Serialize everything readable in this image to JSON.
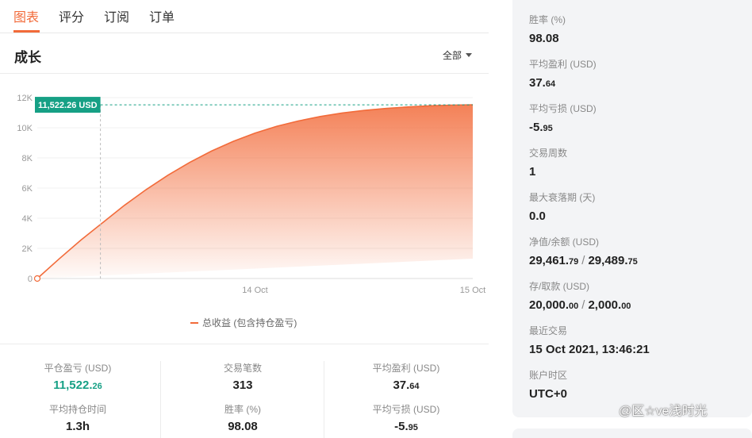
{
  "tabs": [
    {
      "label": "图表",
      "active": true
    },
    {
      "label": "评分",
      "active": false
    },
    {
      "label": "订阅",
      "active": false
    },
    {
      "label": "订单",
      "active": false
    }
  ],
  "growth": {
    "title": "成长",
    "filter_label": "全部"
  },
  "chart_data": {
    "type": "area",
    "series": [
      {
        "name": "总收益 (包含持仓盈亏)",
        "color": "#f26b3a",
        "points": [
          [
            0,
            0
          ],
          [
            0.05,
            1300
          ],
          [
            0.1,
            2550
          ],
          [
            0.15,
            3700
          ],
          [
            0.2,
            4850
          ],
          [
            0.25,
            5900
          ],
          [
            0.3,
            6850
          ],
          [
            0.35,
            7700
          ],
          [
            0.4,
            8450
          ],
          [
            0.45,
            9100
          ],
          [
            0.5,
            9650
          ],
          [
            0.55,
            10100
          ],
          [
            0.6,
            10450
          ],
          [
            0.65,
            10750
          ],
          [
            0.7,
            10980
          ],
          [
            0.75,
            11150
          ],
          [
            0.8,
            11280
          ],
          [
            0.85,
            11380
          ],
          [
            0.9,
            11450
          ],
          [
            0.95,
            11500
          ],
          [
            1.0,
            11522.26
          ]
        ]
      }
    ],
    "y_ticks": [
      "0",
      "2K",
      "4K",
      "6K",
      "8K",
      "10K",
      "12K"
    ],
    "y_tick_values": [
      0,
      2000,
      4000,
      6000,
      8000,
      10000,
      12000
    ],
    "x_ticks": [
      {
        "label": "14 Oct",
        "value": 0.5
      },
      {
        "label": "15 Oct",
        "value": 1.0
      }
    ],
    "ylim": [
      0,
      12000
    ],
    "xlim": [
      0,
      1
    ],
    "tooltip_label": "11,522.26 USD",
    "tooltip_value": 11522.26,
    "crosshair_x": 0.145,
    "legend": "bottom"
  },
  "summary": {
    "closed_pl": {
      "label": "平仓盈亏 (USD)",
      "main": "11,522.",
      "cents": "26"
    },
    "trades": {
      "label": "交易笔数",
      "value": "313"
    },
    "avg_profit": {
      "label": "平均盈利 (USD)",
      "main": "37.",
      "cents": "64"
    },
    "avg_hold": {
      "label": "平均持仓时间",
      "value": "1.3h"
    },
    "win_rate": {
      "label": "胜率 (%)",
      "value": "98.08"
    },
    "avg_loss": {
      "label": "平均亏损 (USD)",
      "main": "-5.",
      "cents": "95"
    }
  },
  "side": {
    "win_rate": {
      "label": "胜率 (%)",
      "value": "98.08"
    },
    "avg_profit": {
      "label": "平均盈利 (USD)",
      "main": "37.",
      "cents": "64"
    },
    "avg_loss": {
      "label": "平均亏损 (USD)",
      "main": "-5.",
      "cents": "95"
    },
    "trade_weeks": {
      "label": "交易周数",
      "value": "1"
    },
    "max_drawdown_period": {
      "label": "最大衰落期 (天)",
      "value": "0.0"
    },
    "equity_balance": {
      "label": "净值/余额 (USD)",
      "a_main": "29,461.",
      "a_cents": "79",
      "sep": "/",
      "b_main": "29,489.",
      "b_cents": "75"
    },
    "deposit_withdraw": {
      "label": "存/取款 (USD)",
      "a_main": "20,000.",
      "a_cents": "00",
      "sep": "/",
      "b_main": "2,000.",
      "b_cents": "00"
    },
    "last_trade": {
      "label": "最近交易",
      "value": "15 Oct 2021, 13:46:21"
    },
    "timezone": {
      "label": "账户时区",
      "value": "UTC+0"
    }
  },
  "watermark": "@区☆ve浅时光",
  "colors": {
    "accent": "#f26b3a",
    "positive": "#16a085",
    "tooltip_bg": "#16a085"
  }
}
